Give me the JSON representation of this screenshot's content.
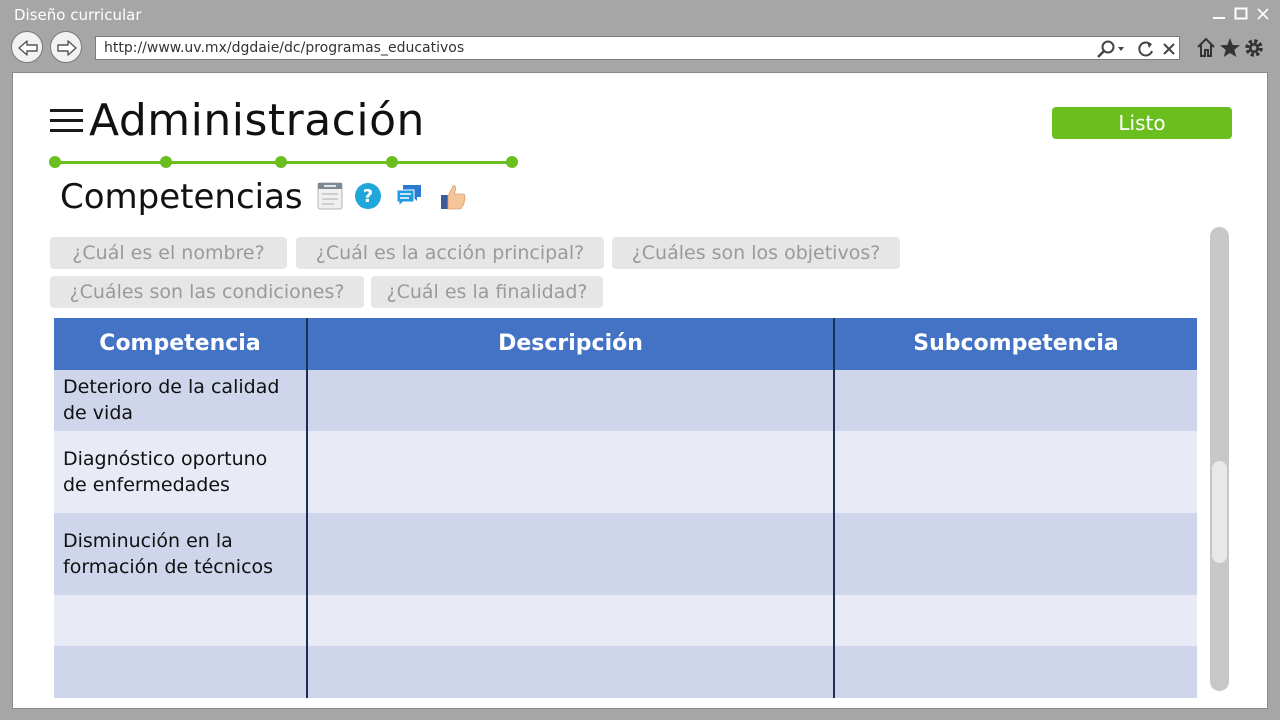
{
  "window": {
    "title": "Diseño curricular",
    "url": "http://www.uv.mx/dgdaie/dc/programas_educativos"
  },
  "page": {
    "title": "Administración",
    "done_label": "Listo",
    "section_title": "Competencias",
    "progress_steps": 5
  },
  "chips": [
    "¿Cuál es el nombre?",
    "¿Cuál es la acción principal?",
    "¿Cuáles son los objetivos?",
    "¿Cuáles son las condiciones?",
    "¿Cuál es la finalidad?"
  ],
  "table": {
    "headers": [
      "Competencia",
      "Descripción",
      "Subcompetencia"
    ],
    "rows": [
      [
        "Deterioro de la calidad de vida",
        "",
        ""
      ],
      [
        "Diagnóstico oportuno de enfermedades",
        "",
        ""
      ],
      [
        "Disminución en la formación de técnicos",
        "",
        ""
      ],
      [
        "",
        "",
        ""
      ],
      [
        "",
        "",
        ""
      ]
    ]
  },
  "colors": {
    "accent_green": "#6abf1e",
    "table_header": "#4472c4",
    "row_odd": "#cfd5ea",
    "row_even": "#e8ebf5"
  },
  "icons": [
    "menu-icon",
    "notes-icon",
    "help-icon",
    "chat-icon",
    "thumbs-up-icon"
  ]
}
